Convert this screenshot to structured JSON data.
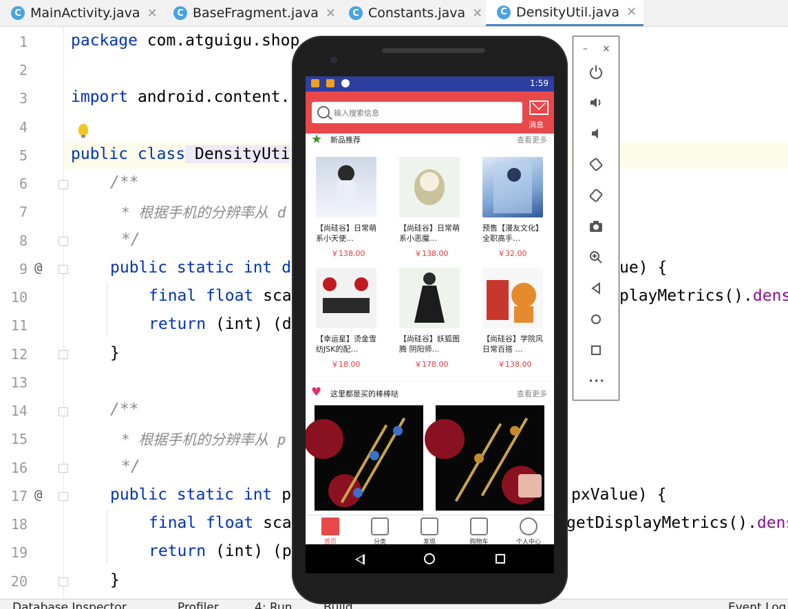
{
  "ide": {
    "tabs": [
      {
        "label": "MainActivity.java",
        "active": false
      },
      {
        "label": "BaseFragment.java",
        "active": false
      },
      {
        "label": "Constants.java",
        "active": false
      },
      {
        "label": "DensityUtil.java",
        "active": true
      }
    ],
    "tab_close_glyph": "✕",
    "tab_badge": "C",
    "line_numbers": [
      "1",
      "2",
      "3",
      "4",
      "5",
      "6",
      "7",
      "8",
      "9",
      "10",
      "11",
      "12",
      "13",
      "14",
      "15",
      "16",
      "17",
      "18",
      "19",
      "20"
    ],
    "gutter_marks": {
      "line9": "@",
      "line17": "@"
    },
    "code": {
      "l1_kw": "package",
      "l1_rest": " com.atguigu.shop",
      "l3_kw": "import",
      "l3_rest": " android.content.",
      "l5_kw": "public class",
      "l5_name": " DensityUti",
      "l6": "/**",
      "l7": "* 根据手机的分辨率从 d",
      "l8": "*/",
      "l9_kw": "public static int",
      "l9_rest": " d",
      "l9_tail": "ue) {",
      "l10_kw": "final float",
      "l10_rest": " sca",
      "l10_tail_a": "playMetrics().",
      "l10_tail_b": "dens",
      "l11_kw": "return",
      "l11_rest": " (int) (d",
      "l12": "}",
      "l14": "/**",
      "l15": "* 根据手机的分辨率从 p",
      "l16": "*/",
      "l17_kw": "public static int",
      "l17_rest": " p",
      "l17_tail": "pxValue) {",
      "l18_kw": "final float",
      "l18_rest": " sca",
      "l18_tail_a": "getDisplayMetrics().",
      "l18_tail_b": "dens",
      "l19_kw": "return",
      "l19_rest": " (int) (p",
      "l20": "}"
    },
    "bottom_tools": [
      "Database Inspector",
      "Profiler",
      "4: Run",
      "Build",
      "Event Log"
    ]
  },
  "phone": {
    "status_time": "1:59",
    "search_placeholder": "输入搜索信息",
    "message_label": "消息",
    "new_section": {
      "title": "新品推荐",
      "more": "查看更多"
    },
    "products": [
      {
        "name": "【尚硅谷】日常萌系小天使…",
        "price": "￥138.00"
      },
      {
        "name": "【尚硅谷】日常萌系小恶魔…",
        "price": "￥138.00"
      },
      {
        "name": "预售【漫友文化】全职高手…",
        "price": "￥32.00"
      },
      {
        "name": "【幸运星】烫金雪纺JSK的配…",
        "price": "￥18.00"
      },
      {
        "name": "【尚硅谷】妖狐图腾 阴阳师…",
        "price": "￥178.00"
      },
      {
        "name": "【尚硅谷】学院风 日常百搭 …",
        "price": "￥138.00"
      }
    ],
    "hot_section": {
      "title": "这里都是买的棒棒哒",
      "more": "查看更多"
    },
    "bottom_nav": [
      {
        "label": "首页",
        "active": true
      },
      {
        "label": "分类",
        "active": false
      },
      {
        "label": "发现",
        "active": false
      },
      {
        "label": "购物车",
        "active": false
      },
      {
        "label": "个人中心",
        "active": false
      }
    ],
    "accent_color": "#e8484a",
    "status_color": "#2c3ea0"
  },
  "emulator_panel": {
    "minimize": "–",
    "close": "×",
    "tools": [
      "power-icon",
      "volume-up-icon",
      "volume-down-icon",
      "rotate-left-icon",
      "rotate-right-icon",
      "camera-icon",
      "zoom-icon",
      "back-icon",
      "home-icon",
      "overview-icon",
      "more-icon"
    ],
    "more_glyph": "•••"
  }
}
